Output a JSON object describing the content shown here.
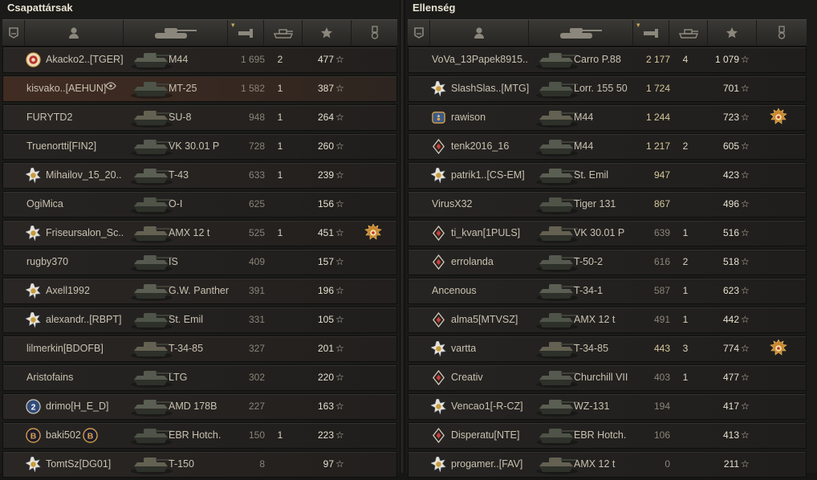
{
  "left_team": {
    "title": "Csapattársak",
    "players": [
      {
        "name": "Akacko2..[TGER]",
        "vehicle": "M44",
        "damage": "1 695",
        "kills": "2",
        "xp": "477",
        "badge": "target",
        "medal": false,
        "damage_hi": false
      },
      {
        "name": "kisvako..[AEHUN]",
        "vehicle": "MT-25",
        "damage": "1 582",
        "kills": "1",
        "xp": "387",
        "badge": "",
        "medal": false,
        "damage_hi": false,
        "spotted_icon": true
      },
      {
        "name": "FURYTD2",
        "vehicle": "SU-8",
        "damage": "948",
        "kills": "1",
        "xp": "264",
        "badge": "",
        "medal": false,
        "damage_hi": false
      },
      {
        "name": "Truenortti[FIN2]",
        "vehicle": "VK 30.01 P",
        "damage": "728",
        "kills": "1",
        "xp": "260",
        "badge": "",
        "medal": false,
        "damage_hi": false
      },
      {
        "name": "Mihailov_15_20..",
        "vehicle": "T-43",
        "damage": "633",
        "kills": "1",
        "xp": "239",
        "badge": "star",
        "medal": false,
        "damage_hi": false
      },
      {
        "name": "OgiMica",
        "vehicle": "O-I",
        "damage": "625",
        "kills": "",
        "xp": "156",
        "badge": "",
        "medal": false,
        "damage_hi": false
      },
      {
        "name": "Friseursalon_Sc..",
        "vehicle": "AMX 12 t",
        "damage": "525",
        "kills": "1",
        "xp": "451",
        "badge": "star",
        "medal": true,
        "damage_hi": false
      },
      {
        "name": "rugby370",
        "vehicle": "IS",
        "damage": "409",
        "kills": "",
        "xp": "157",
        "badge": "",
        "medal": false,
        "damage_hi": false
      },
      {
        "name": "Axell1992",
        "vehicle": "G.W. Panther",
        "damage": "391",
        "kills": "",
        "xp": "196",
        "badge": "star",
        "medal": false,
        "damage_hi": false
      },
      {
        "name": "alexandr..[RBPT]",
        "vehicle": "St. Emil",
        "damage": "331",
        "kills": "",
        "xp": "105",
        "badge": "star",
        "medal": false,
        "damage_hi": false
      },
      {
        "name": "lilmerkin[BDOFB]",
        "vehicle": "T-34-85",
        "damage": "327",
        "kills": "",
        "xp": "201",
        "badge": "",
        "medal": false,
        "damage_hi": false
      },
      {
        "name": "Aristofains",
        "vehicle": "LTG",
        "damage": "302",
        "kills": "",
        "xp": "220",
        "badge": "",
        "medal": false,
        "damage_hi": false
      },
      {
        "name": "drimo[H_E_D]",
        "vehicle": "AMD 178B",
        "damage": "227",
        "kills": "",
        "xp": "163",
        "badge": "two",
        "medal": false,
        "damage_hi": false
      },
      {
        "name": "baki502",
        "vehicle": "EBR Hotch.",
        "damage": "150",
        "kills": "1",
        "xp": "223",
        "badge": "b",
        "medal": false,
        "damage_hi": false,
        "extra_b": true
      },
      {
        "name": "TomtSz[DG01]",
        "vehicle": "T-150",
        "damage": "8",
        "kills": "",
        "xp": "97",
        "badge": "star",
        "medal": false,
        "damage_hi": false
      }
    ]
  },
  "right_team": {
    "title": "Ellenség",
    "players": [
      {
        "name": "VoVa_13Papek8915..",
        "vehicle": "Carro P.88",
        "damage": "2 177",
        "kills": "4",
        "xp": "1 079",
        "badge": "",
        "medal": false,
        "damage_hi": true
      },
      {
        "name": "SlashSlas..[MTG]",
        "vehicle": "Lorr. 155 50",
        "damage": "1 724",
        "kills": "",
        "xp": "701",
        "badge": "star",
        "medal": false,
        "damage_hi": true
      },
      {
        "name": "rawison",
        "vehicle": "M44",
        "damage": "1 244",
        "kills": "",
        "xp": "723",
        "badge": "shield",
        "medal": true,
        "damage_hi": true
      },
      {
        "name": "tenk2016_16",
        "vehicle": "M44",
        "damage": "1 217",
        "kills": "2",
        "xp": "605",
        "badge": "diamond",
        "medal": false,
        "damage_hi": true
      },
      {
        "name": "patrik1..[CS-EM]",
        "vehicle": "St. Emil",
        "damage": "947",
        "kills": "",
        "xp": "423",
        "badge": "star",
        "medal": false,
        "damage_hi": true
      },
      {
        "name": "VirusX32",
        "vehicle": "Tiger 131",
        "damage": "867",
        "kills": "",
        "xp": "496",
        "badge": "",
        "medal": false,
        "damage_hi": true
      },
      {
        "name": "ti_kvan[1PULS]",
        "vehicle": "VK 30.01 P",
        "damage": "639",
        "kills": "1",
        "xp": "516",
        "badge": "diamond",
        "medal": false,
        "damage_hi": false
      },
      {
        "name": "errolanda",
        "vehicle": "T-50-2",
        "damage": "616",
        "kills": "2",
        "xp": "518",
        "badge": "diamond",
        "medal": false,
        "damage_hi": false
      },
      {
        "name": "Ancenous",
        "vehicle": "T-34-1",
        "damage": "587",
        "kills": "1",
        "xp": "623",
        "badge": "",
        "medal": false,
        "damage_hi": false
      },
      {
        "name": "alma5[MTVSZ]",
        "vehicle": "AMX 12 t",
        "damage": "491",
        "kills": "1",
        "xp": "442",
        "badge": "diamond",
        "medal": false,
        "damage_hi": false
      },
      {
        "name": "vartta",
        "vehicle": "T-34-85",
        "damage": "443",
        "kills": "3",
        "xp": "774",
        "badge": "star",
        "medal": true,
        "damage_hi": true
      },
      {
        "name": "Creativ",
        "vehicle": "Churchill VII",
        "damage": "403",
        "kills": "1",
        "xp": "477",
        "badge": "diamond",
        "medal": false,
        "damage_hi": false
      },
      {
        "name": "Vencao1[-R-CZ]",
        "vehicle": "WZ-131",
        "damage": "194",
        "kills": "",
        "xp": "417",
        "badge": "star",
        "medal": false,
        "damage_hi": false
      },
      {
        "name": "Disperatu[NTE]",
        "vehicle": "EBR Hotch.",
        "damage": "106",
        "kills": "",
        "xp": "413",
        "badge": "diamond",
        "medal": false,
        "damage_hi": false
      },
      {
        "name": "progamer..[FAV]",
        "vehicle": "AMX 12 t",
        "damage": "0",
        "kills": "",
        "xp": "211",
        "badge": "star",
        "medal": false,
        "damage_hi": false
      }
    ]
  },
  "icons": {
    "star_glyph": "☆",
    "sort_glyph": "▾",
    "header_columns": [
      "badge-icon",
      "player-icon",
      "tank-icon",
      "damage-icon",
      "kills-icon",
      "xp-icon",
      "medal-icon"
    ]
  },
  "colors": {
    "gold": "#d9a24a",
    "star_badge": "#e8e4d8",
    "diamond_badge": "#c8413a",
    "damage_hi": "#d4c69a"
  }
}
